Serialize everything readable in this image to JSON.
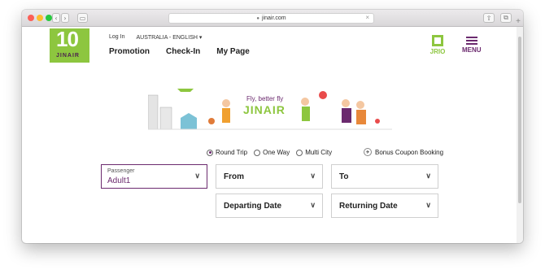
{
  "browser": {
    "url": "jinair.com",
    "clear_icon": "×",
    "add_tab": "+"
  },
  "header": {
    "logo_number": "10",
    "logo_word": "JINAIR",
    "top_links": [
      "Log In",
      "AUSTRALIA - ENGLISH"
    ],
    "nav": [
      "Promotion",
      "Check-In",
      "My Page"
    ],
    "jrio_label": "JRIO",
    "menu_label": "MENU"
  },
  "banner": {
    "tagline": "Fly, better fly",
    "brand": "JINAIR"
  },
  "trip_types": [
    {
      "label": "Round Trip",
      "selected": true
    },
    {
      "label": "One Way",
      "selected": false
    },
    {
      "label": "Multi City",
      "selected": false
    }
  ],
  "bonus_coupon": "Bonus Coupon Booking",
  "form": {
    "passenger_label": "Passenger",
    "passenger_value": "Adult1",
    "from": "From",
    "to": "To",
    "departing": "Departing Date",
    "returning": "Returning Date"
  },
  "colors": {
    "brand_green": "#8dc63f",
    "brand_purple": "#6b2a6e"
  }
}
